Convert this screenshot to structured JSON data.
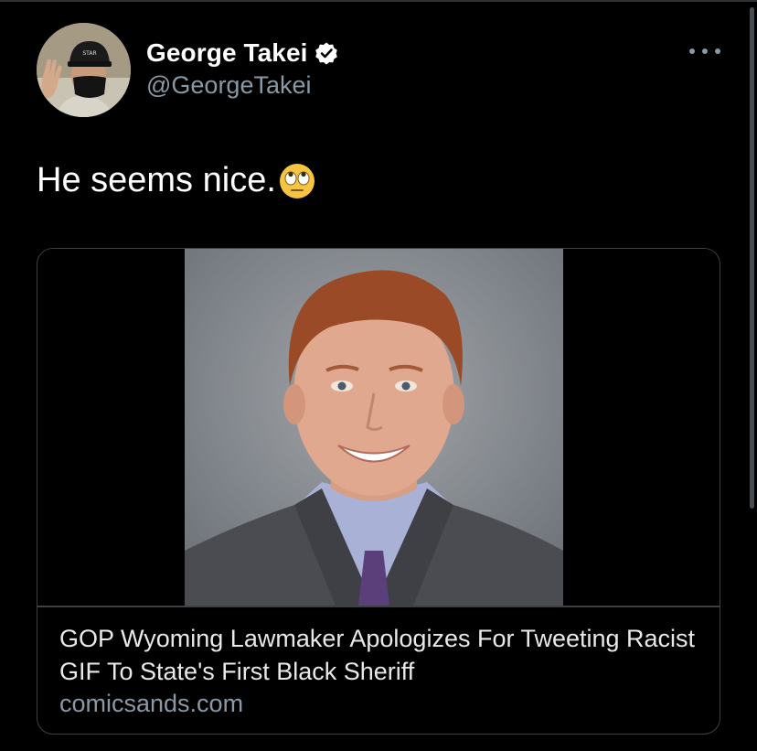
{
  "author": {
    "display_name": "George Takei",
    "handle": "@GeorgeTakei",
    "verified": true
  },
  "tweet": {
    "text": "He seems nice.",
    "emoji": "face-with-rolling-eyes-icon"
  },
  "link_card": {
    "title": "GOP Wyoming Lawmaker Apologizes For Tweeting Racist GIF To State's First Black Sheriff",
    "domain": "comicsands.com"
  },
  "colors": {
    "background": "#000000",
    "primary_text": "#e7e9ea",
    "secondary_text": "#8b98a5",
    "border": "#3e4144",
    "verified_badge": "#ffffff"
  },
  "icons": [
    "more-options-icon",
    "verified-badge-icon",
    "face-with-rolling-eyes-icon"
  ]
}
